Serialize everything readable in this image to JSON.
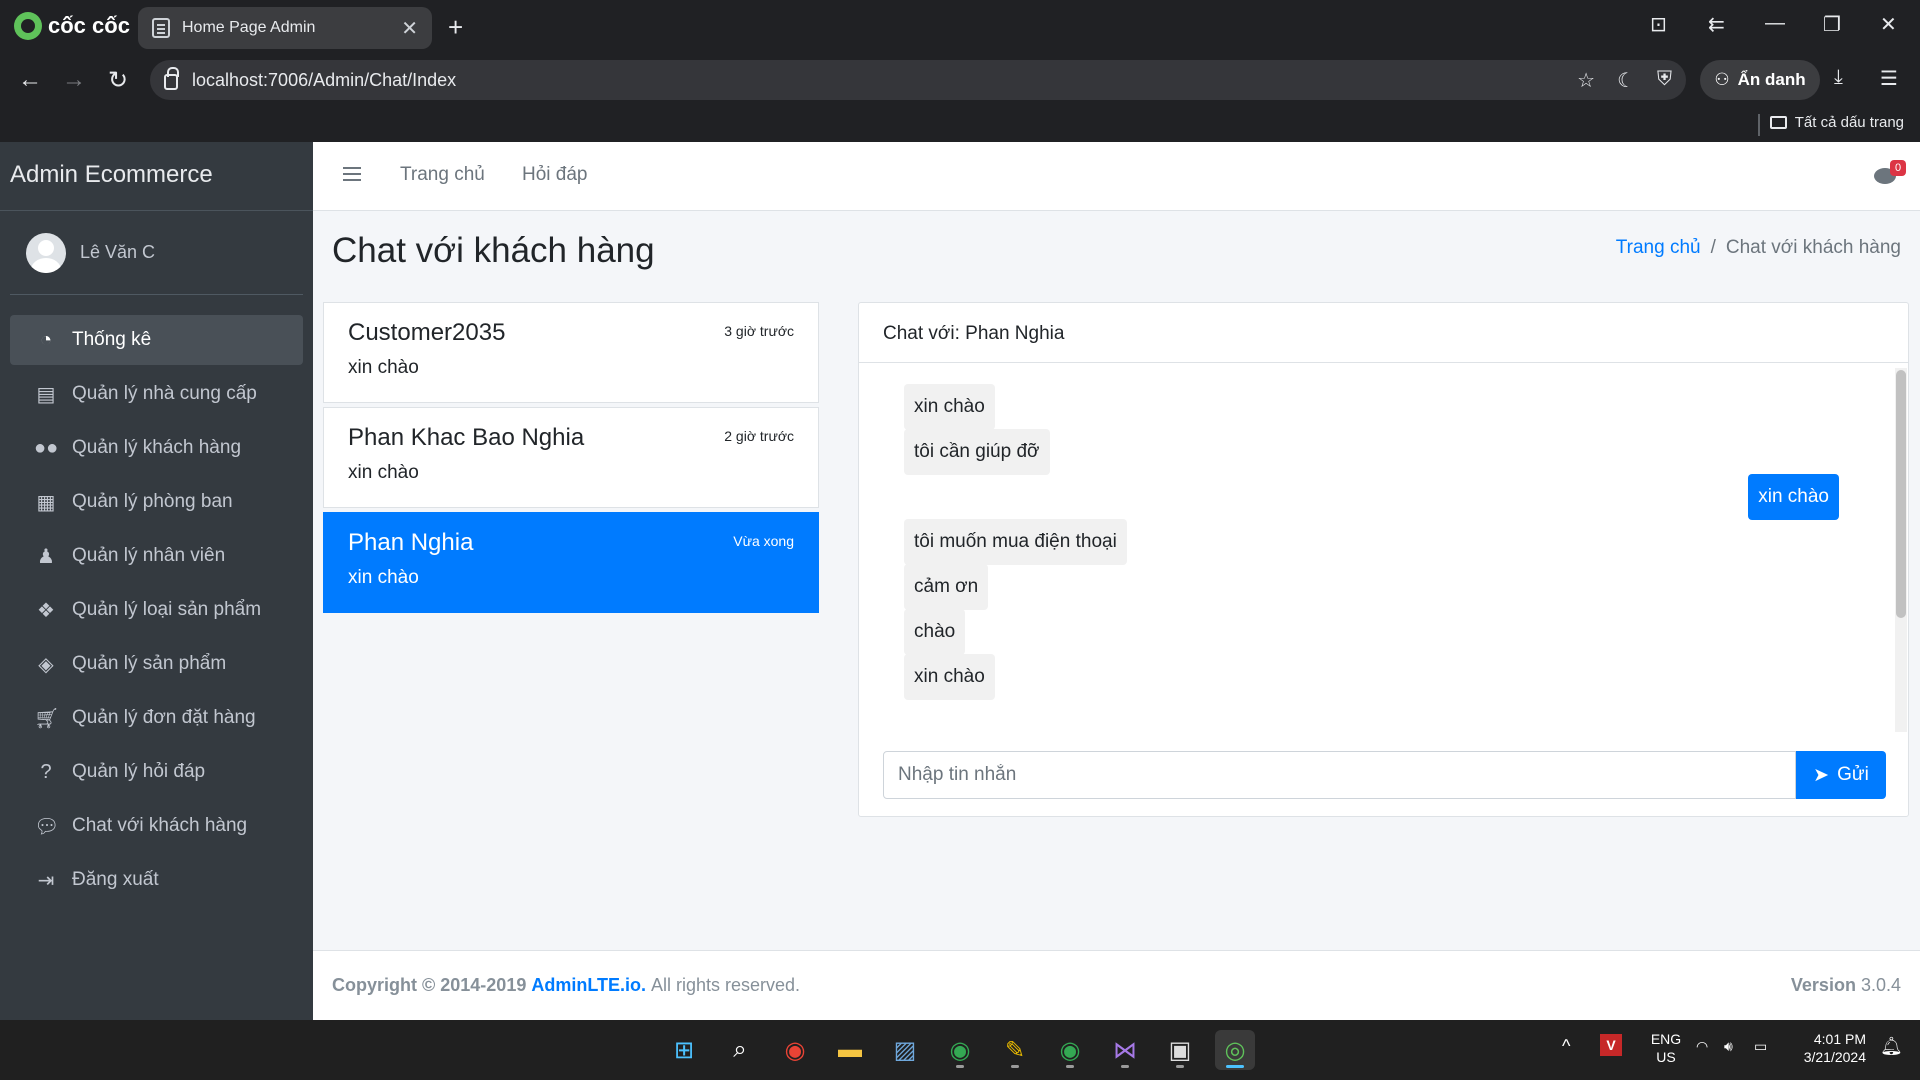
{
  "browser": {
    "brand": "cốc cốc",
    "tab_title": "Home Page Admin",
    "url": "localhost:7006/Admin/Chat/Index",
    "incognito_label": "Ẩn danh",
    "bookmarks_all": "Tất cả dấu trang"
  },
  "sidebar": {
    "brand": "Admin Ecommerce",
    "user_name": "Lê Văn C",
    "items": [
      {
        "label": "Thống kê",
        "icon": "tachometer-icon"
      },
      {
        "label": "Quản lý nhà cung cấp",
        "icon": "store-icon"
      },
      {
        "label": "Quản lý khách hàng",
        "icon": "users-icon"
      },
      {
        "label": "Quản lý phòng ban",
        "icon": "building-icon"
      },
      {
        "label": "Quản lý nhân viên",
        "icon": "user-tie-icon"
      },
      {
        "label": "Quản lý loại sản phẩm",
        "icon": "cubes-icon"
      },
      {
        "label": "Quản lý sản phẩm",
        "icon": "box-icon"
      },
      {
        "label": "Quản lý đơn đặt hàng",
        "icon": "cart-icon"
      },
      {
        "label": "Quản lý hỏi đáp",
        "icon": "question-icon"
      },
      {
        "label": "Chat với khách hàng",
        "icon": "comments-icon"
      },
      {
        "label": "Đăng xuất",
        "icon": "sign-out-icon"
      }
    ]
  },
  "topnav": {
    "home": "Trang chủ",
    "qa": "Hỏi đáp",
    "notification_count": "0"
  },
  "page": {
    "title": "Chat với khách hàng",
    "breadcrumb_home": "Trang chủ",
    "breadcrumb_sep": "/",
    "breadcrumb_current": "Chat với khách hàng"
  },
  "conversations": [
    {
      "name": "Customer2035",
      "last_message": "xin chào",
      "time": "3 giờ trước",
      "active": false
    },
    {
      "name": "Phan Khac Bao Nghia",
      "last_message": "xin chào",
      "time": "2 giờ trước",
      "active": false
    },
    {
      "name": "Phan Nghia",
      "last_message": "xin chào",
      "time": "Vừa xong",
      "active": true
    }
  ],
  "chat": {
    "header": "Chat với: Phan Nghia",
    "messages": [
      {
        "text": "xin chào",
        "from": "customer"
      },
      {
        "text": "tôi cần giúp đỡ",
        "from": "customer"
      },
      {
        "text": "xin chào",
        "from": "admin"
      },
      {
        "text": "tôi muốn mua điện thoại",
        "from": "customer"
      },
      {
        "text": "cảm ơn",
        "from": "customer"
      },
      {
        "text": "chào",
        "from": "customer"
      },
      {
        "text": "xin chào",
        "from": "customer"
      }
    ],
    "input_placeholder": "Nhập tin nhắn",
    "send_label": "Gửi"
  },
  "footer": {
    "copyright_prefix": "Copyright © 2014-2019",
    "brand": "AdminLTE.io.",
    "rights": "All rights reserved.",
    "version_label": "Version",
    "version_number": "3.0.4"
  },
  "taskbar": {
    "lang": "ENG",
    "region": "US",
    "time": "4:01 PM",
    "date": "3/21/2024"
  }
}
